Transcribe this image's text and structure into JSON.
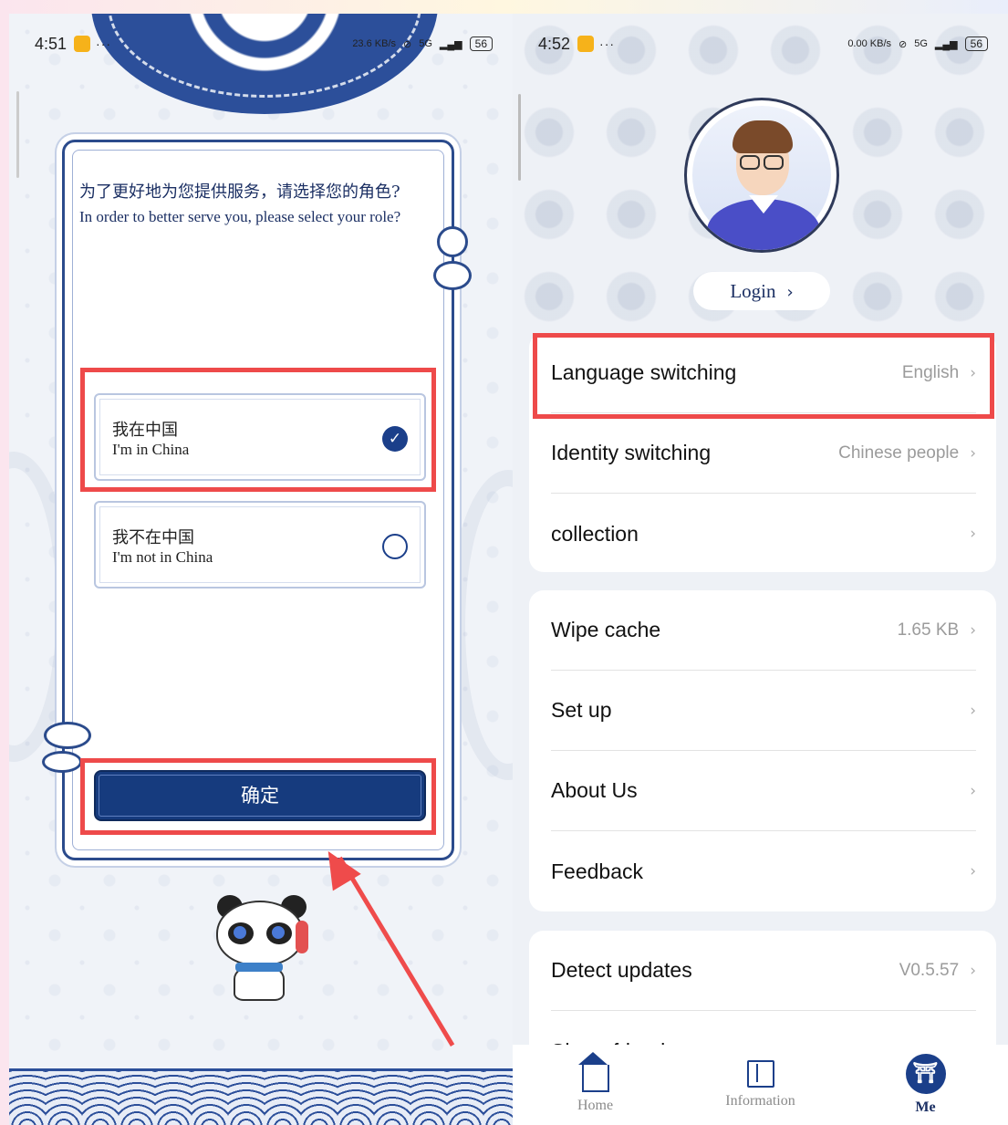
{
  "left_screen": {
    "status": {
      "time": "4:51",
      "net": "23.6 KB/s",
      "signal": "5G",
      "battery": "56"
    },
    "dialog": {
      "title_cn": "为了更好地为您提供服务，请选择您的角色?",
      "title_en": "In order to better serve you, please select your role?",
      "options": [
        {
          "cn": "我在中国",
          "en": "I'm in China",
          "selected": true
        },
        {
          "cn": "我不在中国",
          "en": "I'm not in China",
          "selected": false
        }
      ],
      "confirm_label": "确定"
    }
  },
  "right_screen": {
    "status": {
      "time": "4:52",
      "net": "0.00 KB/s",
      "signal": "5G",
      "battery": "56"
    },
    "login_label": "Login",
    "groups": [
      {
        "rows": [
          {
            "label": "Language switching",
            "value": "English"
          },
          {
            "label": "Identity switching",
            "value": "Chinese people"
          },
          {
            "label": "collection",
            "value": ""
          }
        ]
      },
      {
        "rows": [
          {
            "label": "Wipe cache",
            "value": "1.65 KB"
          },
          {
            "label": "Set up",
            "value": ""
          },
          {
            "label": "About Us",
            "value": ""
          },
          {
            "label": "Feedback",
            "value": ""
          }
        ]
      },
      {
        "rows": [
          {
            "label": "Detect updates",
            "value": "V0.5.57"
          },
          {
            "label": "Share friends",
            "value": ""
          }
        ]
      }
    ],
    "tabbar": [
      {
        "label": "Home",
        "icon": "home-icon",
        "active": false
      },
      {
        "label": "Information",
        "icon": "book-icon",
        "active": false
      },
      {
        "label": "Me",
        "icon": "me-icon",
        "active": true
      }
    ]
  },
  "colors": {
    "accent": "#1b3f8a",
    "highlight": "#ee4a4a"
  }
}
